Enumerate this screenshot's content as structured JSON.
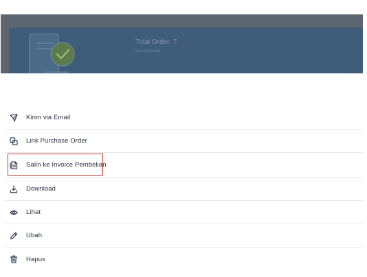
{
  "background": {
    "total_order": "Total Order: 7",
    "subtitle": "Sesuai pesan"
  },
  "menu": {
    "items": [
      {
        "label": "Kirim via Email",
        "icon": "send-icon"
      },
      {
        "label": "Link Purchase Order",
        "icon": "copy-link-icon"
      },
      {
        "label": "Salin ke Invoice Pembelian",
        "icon": "document-copy-icon",
        "highlighted": true
      },
      {
        "label": "Download",
        "icon": "download-icon"
      },
      {
        "label": "Lihat",
        "icon": "eye-icon"
      },
      {
        "label": "Ubah",
        "icon": "pencil-icon"
      },
      {
        "label": "Hapus",
        "icon": "trash-icon"
      }
    ]
  },
  "colors": {
    "overlay": "#5d6670",
    "card": "#3f5c7a",
    "highlight_border": "#c0392b",
    "text": "#2b3340"
  }
}
